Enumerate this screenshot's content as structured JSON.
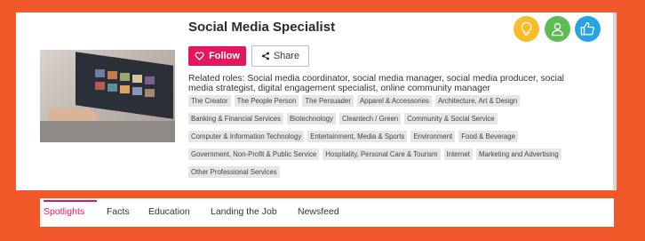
{
  "career": {
    "title": "Social Media Specialist",
    "related_roles": "Related roles: Social media coordinator, social media manager, social media producer, social media strategist, digital engagement specialist, online community manager"
  },
  "actions": {
    "follow_label": "Follow",
    "share_label": "Share"
  },
  "tags": [
    [
      "The Creator",
      "The People Person",
      "The Persuader",
      "Apparel & Accessories",
      "Architecture, Art & Design"
    ],
    [
      "Banking & Financial Services",
      "Biotechnology",
      "Cleantech / Green",
      "Community & Social Service"
    ],
    [
      "Computer & Information Technology",
      "Entertainment, Media & Sports",
      "Environment",
      "Food & Beverage"
    ],
    [
      "Government, Non-Profit & Public Service",
      "Hospitality, Personal Care & Tourism",
      "Internet",
      "Marketing and Advertising"
    ],
    [
      "Other Professional Services"
    ]
  ],
  "badges": [
    {
      "icon": "lightbulb-icon",
      "color": "#f7bd2d"
    },
    {
      "icon": "person-icon",
      "color": "#5fbb53"
    },
    {
      "icon": "thumbs-up-icon",
      "color": "#27a3e5"
    }
  ],
  "tabs": [
    "Spotlights",
    "Facts",
    "Education",
    "Landing the Job",
    "Newsfeed"
  ],
  "colors": {
    "brand_background": "#f1592a",
    "accent": "#e2185b"
  }
}
